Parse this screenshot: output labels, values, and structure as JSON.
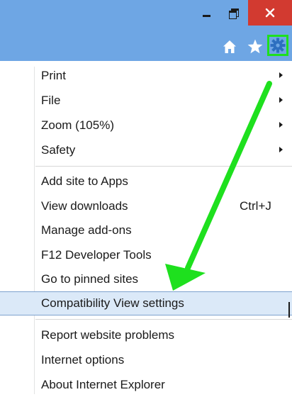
{
  "window": {
    "controls": {
      "minimize_icon": "minimize-icon",
      "restore_icon": "restore-icon",
      "close_icon": "close-icon"
    },
    "toolbar": {
      "icons": [
        "home-icon",
        "star-icon",
        "gear-icon"
      ]
    }
  },
  "menu": {
    "items": [
      {
        "label": "Print",
        "submenu": true
      },
      {
        "label": "File",
        "submenu": true
      },
      {
        "label": "Zoom (105%)",
        "submenu": true
      },
      {
        "label": "Safety",
        "submenu": true
      },
      {
        "label": "Add site to Apps"
      },
      {
        "label": "View downloads",
        "shortcut": "Ctrl+J"
      },
      {
        "label": "Manage add-ons"
      },
      {
        "label": "F12 Developer Tools"
      },
      {
        "label": "Go to pinned sites"
      },
      {
        "label": "Compatibility View settings",
        "highlighted": true
      },
      {
        "label": "Report website problems"
      },
      {
        "label": "Internet options"
      },
      {
        "label": "About Internet Explorer"
      }
    ]
  },
  "colors": {
    "titlebar": "#6ea6e4",
    "close_button": "#d23a30",
    "highlight": "#dbe9f8",
    "annotation_arrow": "#1ee01e"
  }
}
